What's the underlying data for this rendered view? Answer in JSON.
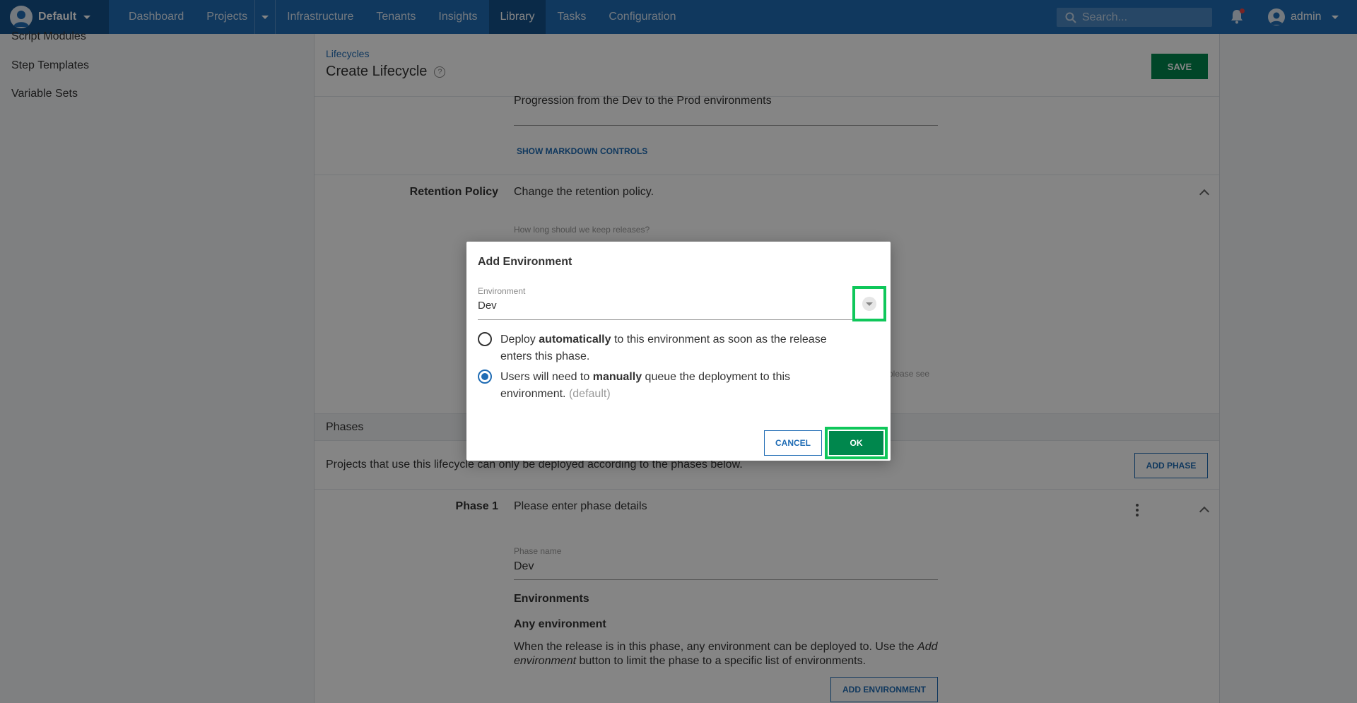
{
  "nav": {
    "space": "Default",
    "items": [
      "Dashboard",
      "Projects",
      "Infrastructure",
      "Tenants",
      "Insights",
      "Library",
      "Tasks",
      "Configuration"
    ],
    "active": "Library",
    "search_placeholder": "Search...",
    "user": "admin"
  },
  "sidebar": {
    "items": [
      "Script Modules",
      "Step Templates",
      "Variable Sets"
    ]
  },
  "page": {
    "breadcrumb": "Lifecycles",
    "title": "Create Lifecycle",
    "save_label": "SAVE",
    "description_value": "Progression from the Dev to the Prod environments",
    "markdown_link": "SHOW MARKDOWN CONTROLS",
    "retention": {
      "label": "Retention Policy",
      "summary": "Change the retention policy.",
      "question": "How long should we keep releases?",
      "partial_hint": "please see"
    },
    "phases": {
      "title": "Phases",
      "description": "Projects that use this lifecycle can only be deployed according to the phases below.",
      "add_phase_label": "ADD PHASE",
      "phase1": {
        "label": "Phase 1",
        "summary": "Please enter phase details",
        "name_label": "Phase name",
        "name_value": "Dev",
        "environments_heading": "Environments",
        "any_env_heading": "Any environment",
        "env_desc_part1": "When the release is in this phase, any environment can be deployed to. Use the",
        "env_desc_em": "Add environment",
        "env_desc_part2": "button to limit the phase to a specific list of environments.",
        "add_env_label": "ADD ENVIRONMENT"
      }
    }
  },
  "dialog": {
    "title": "Add Environment",
    "env_label": "Environment",
    "env_value": "Dev",
    "option_auto": {
      "pre": "Deploy",
      "bold": "automatically",
      "post": "to this environment as soon as the release enters this phase.",
      "selected": false
    },
    "option_manual": {
      "pre": "Users will need to",
      "bold": "manually",
      "post": "queue the deployment to this environment.",
      "suffix": "(default)",
      "selected": true
    },
    "cancel_label": "CANCEL",
    "ok_label": "OK"
  },
  "colors": {
    "nav_bg": "#1f6cb4",
    "nav_active": "#15518a",
    "primary_green": "#00874d",
    "highlight": "#0fc75a"
  }
}
